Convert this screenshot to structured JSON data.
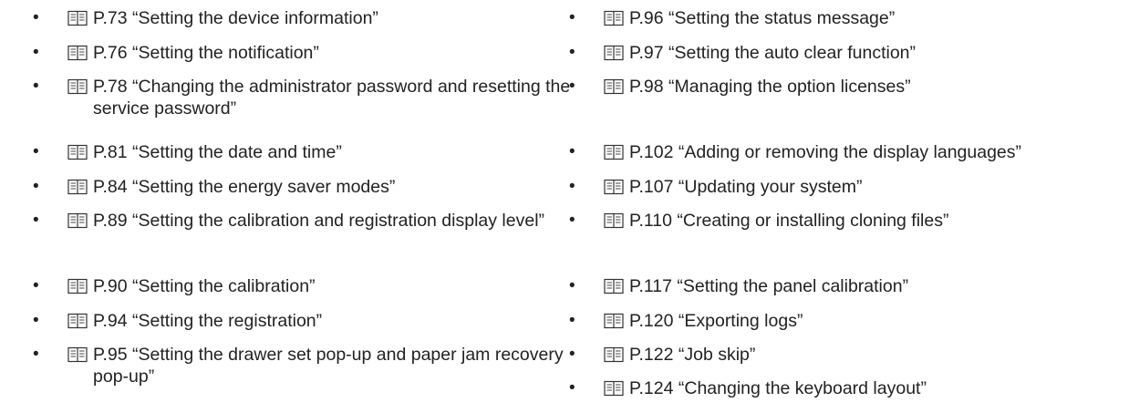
{
  "icon": "book-reference-icon",
  "bullet": "•",
  "left_column": [
    {
      "page": "P.73",
      "title": "“Setting the device information”"
    },
    {
      "page": "P.76",
      "title": "“Setting the notification”"
    },
    {
      "page": "P.78",
      "title": "“Changing the administrator password and resetting the service password”"
    },
    {
      "page": "P.81",
      "title": "“Setting the date and time”"
    },
    {
      "page": "P.84",
      "title": "“Setting the energy saver modes”"
    },
    {
      "page": "P.89",
      "title": "“Setting the calibration and registration display level”"
    },
    {
      "page": "P.90",
      "title": "“Setting the calibration”"
    },
    {
      "page": "P.94",
      "title": "“Setting the registration”"
    },
    {
      "page": "P.95",
      "title": "“Setting the drawer set pop-up and paper jam recovery pop-up”"
    }
  ],
  "right_column": [
    {
      "page": "P.96",
      "title": "“Setting the status message”"
    },
    {
      "page": "P.97",
      "title": "“Setting the auto clear function”"
    },
    {
      "page": "P.98",
      "title": "“Managing the option licenses”"
    },
    {
      "page": "P.102",
      "title": "“Adding or removing the display languages”"
    },
    {
      "page": "P.107",
      "title": "“Updating your system”"
    },
    {
      "page": "P.110",
      "title": "“Creating or installing cloning files”"
    },
    {
      "page": "P.117",
      "title": "“Setting the panel calibration”"
    },
    {
      "page": "P.120",
      "title": "“Exporting logs”"
    },
    {
      "page": "P.122",
      "title": "“Job skip”"
    },
    {
      "page": "P.124",
      "title": "“Changing the keyboard layout”"
    }
  ]
}
